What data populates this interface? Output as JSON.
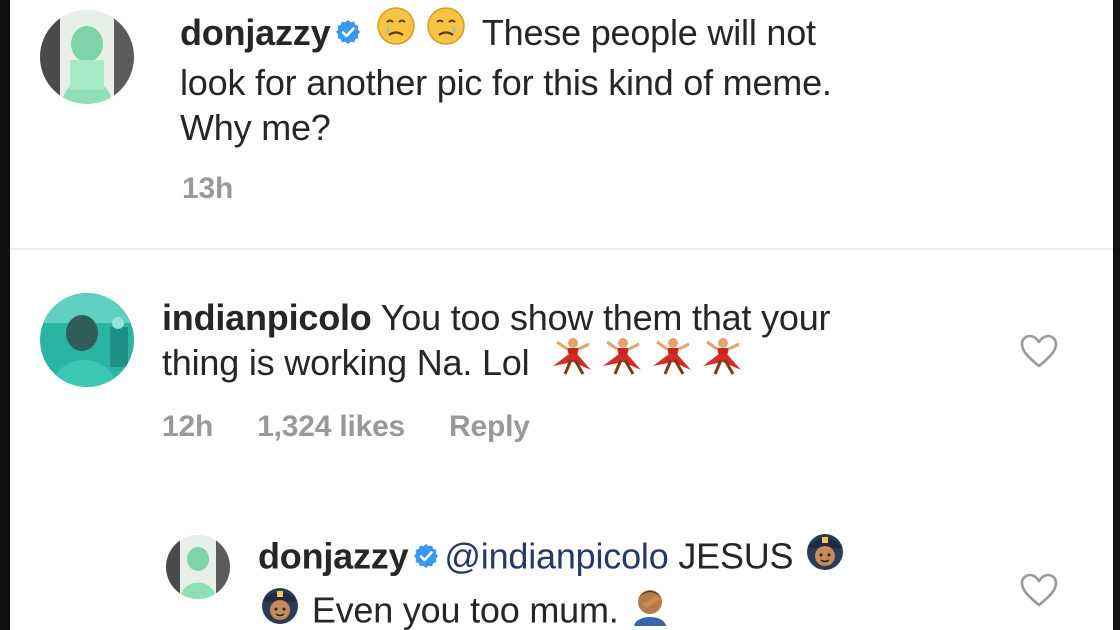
{
  "comments": [
    {
      "username": "donjazzy",
      "verified": true,
      "emojis": [
        "crying-face-emoji",
        "crying-face-emoji"
      ],
      "text_line1": "These people will not",
      "text_line2": "look for another pic for this kind of meme.",
      "text_line3": "Why me?",
      "time": "13h"
    },
    {
      "username": "indianpicolo",
      "text_line1": "You too show them that your",
      "text_line2": "thing is working Na. Lol",
      "emojis": [
        "dancer-emoji",
        "dancer-emoji",
        "dancer-emoji",
        "dancer-emoji"
      ],
      "time": "12h",
      "likes": "1,324 likes",
      "reply_label": "Reply",
      "liked": false
    },
    {
      "username": "donjazzy",
      "verified": true,
      "mention": "@indianpicolo",
      "text_word": "JESUS",
      "text_line2": "Even you too mum.",
      "emojis": [
        "police-officer-emoji",
        "police-officer-emoji",
        "person-facepalming-emoji"
      ],
      "liked": false
    }
  ],
  "colors": {
    "text": "#262626",
    "meta": "#999999",
    "verified": "#3897f0",
    "mention": "#23396b",
    "divider": "#ececec"
  }
}
